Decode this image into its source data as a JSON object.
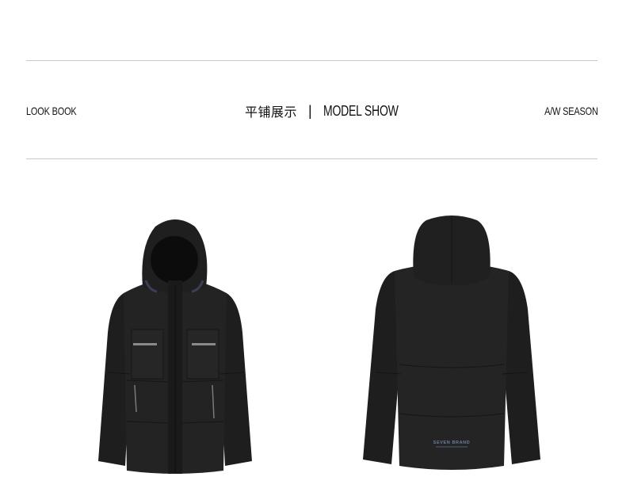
{
  "header": {
    "left_label": "LOOK BOOK",
    "cn_title": "平铺展示",
    "divider": "|",
    "en_title": "MODEL SHOW",
    "right_label": "A/W SEASON"
  },
  "products": {
    "front": {
      "view": "front",
      "color": "#1c1c1c"
    },
    "back": {
      "view": "back",
      "color": "#1c1c1c",
      "logo": "SEVEN BRAND"
    }
  },
  "colors": {
    "background": "#ffffff",
    "rule": "#c8c8c8",
    "jacket": "#1c1c1c"
  }
}
